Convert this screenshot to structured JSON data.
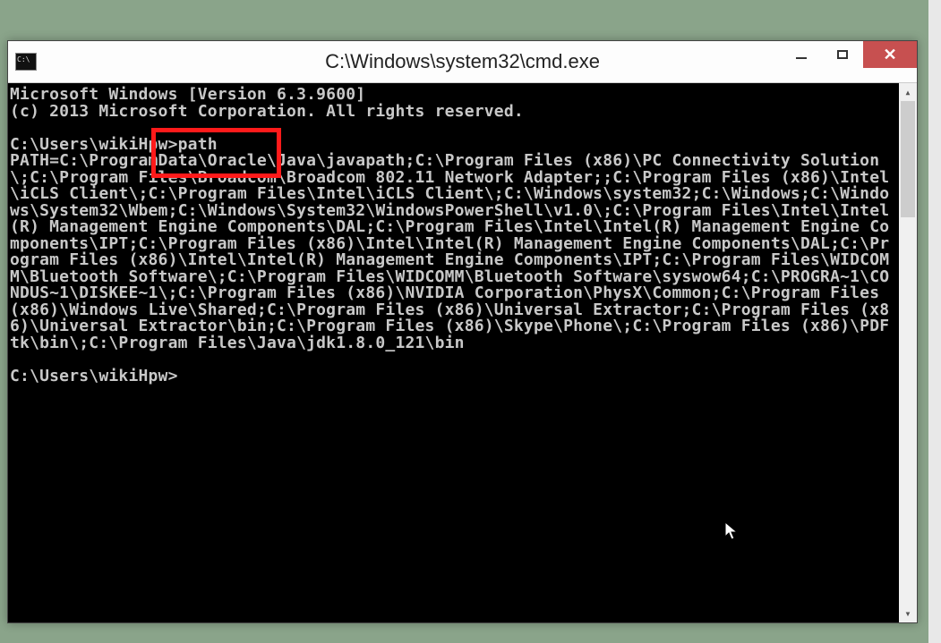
{
  "window": {
    "title": "C:\\Windows\\system32\\cmd.exe"
  },
  "terminal": {
    "lines": [
      "Microsoft Windows [Version 6.3.9600]",
      "(c) 2013 Microsoft Corporation. All rights reserved.",
      "",
      "C:\\Users\\wikiHpw>path",
      "PATH=C:\\ProgramData\\Oracle\\Java\\javapath;C:\\Program Files (x86)\\PC Connectivity Solution\\;C:\\Program Files\\Broadcom\\Broadcom 802.11 Network Adapter;;C:\\Program Files (x86)\\Intel\\iCLS Client\\;C:\\Program Files\\Intel\\iCLS Client\\;C:\\Windows\\system32;C:\\Windows;C:\\Windows\\System32\\Wbem;C:\\Windows\\System32\\WindowsPowerShell\\v1.0\\;C:\\Program Files\\Intel\\Intel(R) Management Engine Components\\DAL;C:\\Program Files\\Intel\\Intel(R) Management Engine Components\\IPT;C:\\Program Files (x86)\\Intel\\Intel(R) Management Engine Components\\DAL;C:\\Program Files (x86)\\Intel\\Intel(R) Management Engine Components\\IPT;C:\\Program Files\\WIDCOMM\\Bluetooth Software\\;C:\\Program Files\\WIDCOMM\\Bluetooth Software\\syswow64;C:\\PROGRA~1\\CONDUS~1\\DISKEE~1\\;C:\\Program Files (x86)\\NVIDIA Corporation\\PhysX\\Common;C:\\Program Files (x86)\\Windows Live\\Shared;C:\\Program Files (x86)\\Universal Extractor;C:\\Program Files (x86)\\Universal Extractor\\bin;C:\\Program Files (x86)\\Skype\\Phone\\;C:\\Program Files (x86)\\PDFtk\\bin\\;C:\\Program Files\\Java\\jdk1.8.0_121\\bin",
      "",
      "C:\\Users\\wikiHpw>"
    ]
  },
  "highlight": {
    "line1": "pw>path",
    "line2": "mData\\Orac"
  }
}
